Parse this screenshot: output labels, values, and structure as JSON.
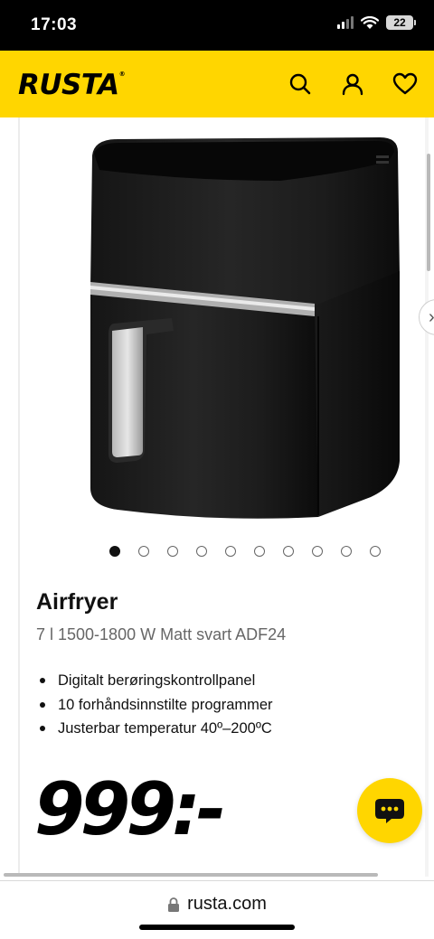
{
  "status_bar": {
    "time": "17:03",
    "battery": "22"
  },
  "header": {
    "logo": "RUSTA",
    "logo_mark": "®",
    "icons": [
      "search-icon",
      "account-icon",
      "heart-icon"
    ],
    "background": "#FFD600"
  },
  "gallery": {
    "total_images": 10,
    "active_index": 0,
    "next_icon": "chevron-right-icon",
    "next_glyph": "›"
  },
  "product": {
    "title": "Airfryer",
    "subtitle": "7 l 1500-1800 W Matt svart ADF24",
    "features": [
      "Digitalt berøringskontrollpanel",
      "10 forhåndsinnstilte programmer",
      "Justerbar temperatur 40º–200ºC"
    ],
    "price": "999:-"
  },
  "chat": {
    "icon": "chat-icon",
    "background": "#FFD600"
  },
  "browser": {
    "url": "rusta.com",
    "lock_icon": "lock-icon"
  }
}
